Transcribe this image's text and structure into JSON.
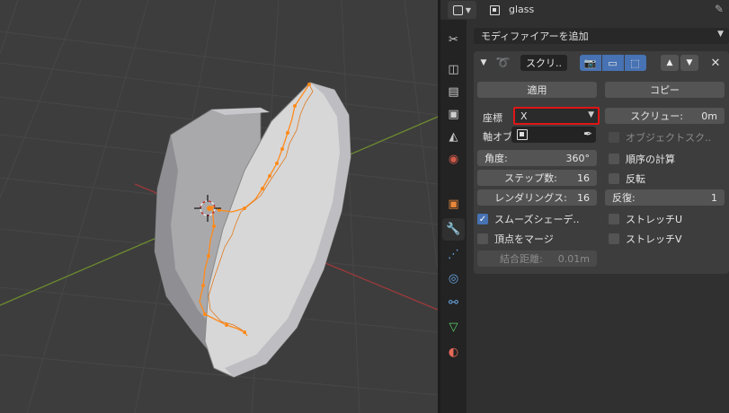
{
  "header": {
    "object_name": "glass"
  },
  "modifier_panel": {
    "add_modifier_label": "モディファイアーを追加",
    "modifier_name": "スクリ..",
    "apply_label": "適用",
    "copy_label": "コピー",
    "axis_label": "座標",
    "axis_value": "X",
    "screw_label": "スクリュー:",
    "screw_value": "0m",
    "axis_object_label": "軸オブ",
    "object_screw_label": "オブジェクトスク..",
    "angle_label": "角度:",
    "angle_value": "360°",
    "calc_order_label": "順序の計算",
    "steps_label": "ステップ数:",
    "steps_value": "16",
    "flip_label": "反転",
    "render_steps_label": "レンダリングス:",
    "render_steps_value": "16",
    "iterations_label": "反復:",
    "iterations_value": "1",
    "smooth_shading_label": "スムーズシェーデ..",
    "stretch_u_label": "ストレッチU",
    "merge_vertices_label": "頂点をマージ",
    "stretch_v_label": "ストレッチV",
    "merge_distance_label": "結合距離:",
    "merge_distance_value": "0.01m",
    "checkboxes": {
      "object_screw": false,
      "calc_order": false,
      "flip": false,
      "smooth_shading": true,
      "stretch_u": false,
      "merge_vertices": false,
      "stretch_v": false
    }
  },
  "colors": {
    "accent_blue": "#4772b3",
    "highlight_red": "#e01515",
    "edge_orange": "#ff8a1a"
  },
  "icons": {
    "editor_type": "properties-editor-icon",
    "object": "object-icon",
    "pin": "pin-icon",
    "tabs": [
      "tool-icon",
      "render-icon",
      "output-icon",
      "view-layer-icon",
      "scene-icon",
      "world-icon",
      "object-icon",
      "modifier-icon",
      "particles-icon",
      "physics-icon",
      "constraints-icon",
      "data-icon",
      "material-icon"
    ]
  }
}
